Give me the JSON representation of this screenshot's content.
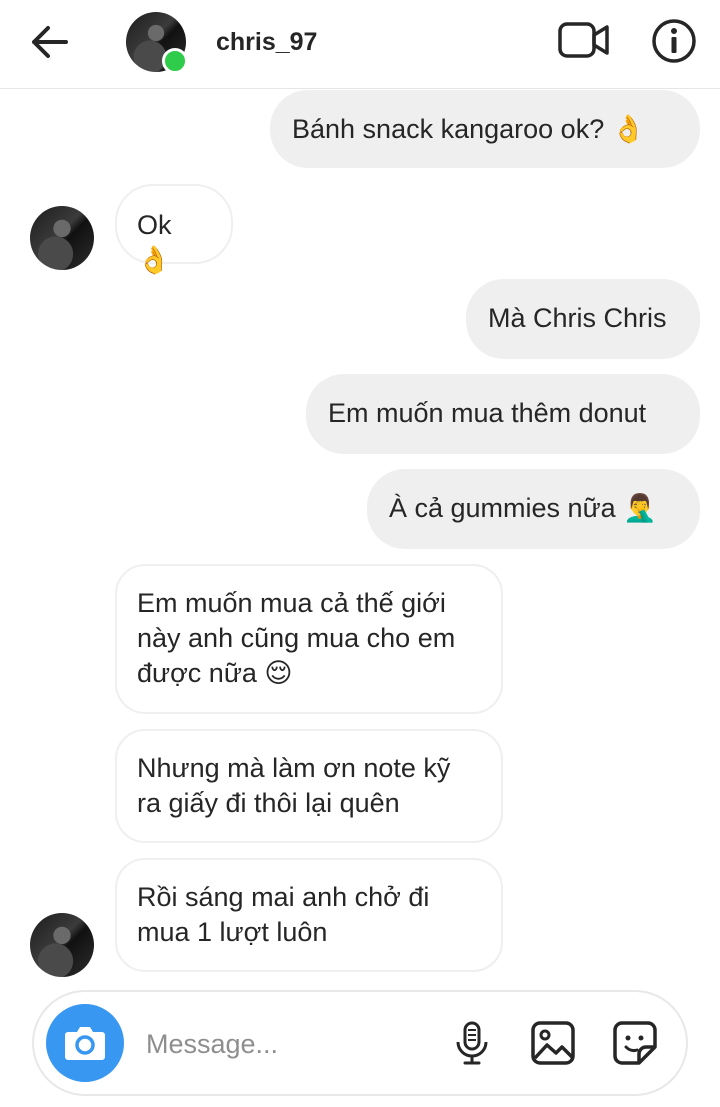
{
  "header": {
    "username": "chris_97",
    "icons": {
      "back": "arrow-left-icon",
      "video": "video-camera-icon",
      "info": "info-icon"
    }
  },
  "messages": [
    {
      "sender": "me",
      "text": "Bánh snack kangaroo ok? 👌"
    },
    {
      "sender": "chris_97",
      "text": "Ok 👌"
    },
    {
      "sender": "me",
      "text": "Mà Chris Chris"
    },
    {
      "sender": "me",
      "text": "Em muốn mua thêm donut"
    },
    {
      "sender": "me",
      "text": "À cả gummies nữa 🤦‍♂️"
    },
    {
      "sender": "chris_97",
      "text": "Em muốn mua cả thế giới này anh cũng mua cho em được nữa 😌"
    },
    {
      "sender": "chris_97",
      "text": "Nhưng mà làm ơn note kỹ ra giấy đi thôi lại quên"
    },
    {
      "sender": "chris_97",
      "text": "Rồi sáng mai anh chở đi mua 1 lượt luôn"
    }
  ],
  "composer": {
    "placeholder": "Message...",
    "icons": {
      "camera": "camera-icon",
      "mic": "microphone-icon",
      "gallery": "image-icon",
      "sticker": "sticker-icon"
    }
  },
  "colors": {
    "accent": "#3897f0",
    "online": "#2ecc4a",
    "my_bubble": "#efefef"
  }
}
